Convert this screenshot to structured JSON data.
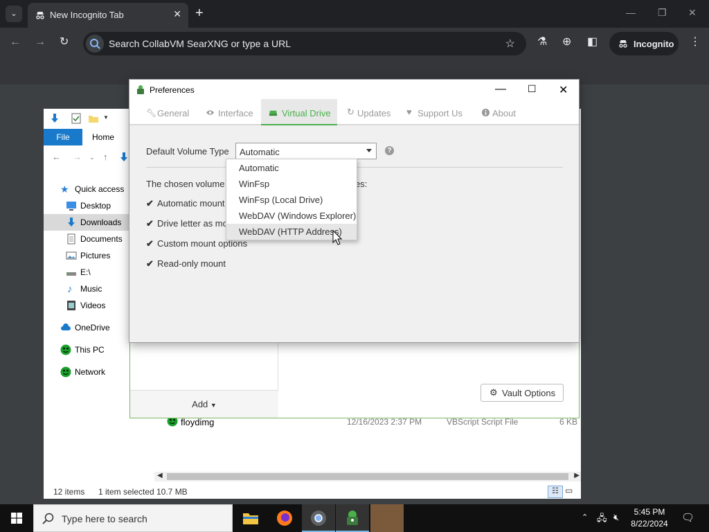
{
  "browser": {
    "tab_title": "New Incognito Tab",
    "omnibox_placeholder": "Search CollabVM SearXNG or type a URL",
    "incognito_label": "Incognito"
  },
  "explorer": {
    "ribbon": {
      "file_tab": "File",
      "home_tab": "Home"
    },
    "sidebar": [
      {
        "label": "Quick access",
        "icon": "star-icon"
      },
      {
        "label": "Desktop",
        "icon": "desktop-icon"
      },
      {
        "label": "Downloads",
        "icon": "download-icon",
        "selected": true
      },
      {
        "label": "Documents",
        "icon": "document-icon"
      },
      {
        "label": "Pictures",
        "icon": "pictures-icon"
      },
      {
        "label": "E:\\",
        "icon": "drive-icon"
      },
      {
        "label": "Music",
        "icon": "music-icon"
      },
      {
        "label": "Videos",
        "icon": "video-icon"
      },
      {
        "label": "OneDrive",
        "icon": "cloud-icon"
      },
      {
        "label": "This PC",
        "icon": "pc-icon"
      },
      {
        "label": "Network",
        "icon": "network-icon"
      }
    ],
    "file_row": {
      "name": "floydimg",
      "date": "12/16/2023 2:37 PM",
      "type": "VBScript Script File",
      "size": "6 KB"
    },
    "status": {
      "items": "12 items",
      "selected": "1 item selected",
      "size": "10.7 MB"
    }
  },
  "cryptomator": {
    "add_label": "Add",
    "vault_options_label": "Vault Options"
  },
  "preferences": {
    "title": "Preferences",
    "tabs": [
      {
        "label": "General",
        "icon": "wrench-icon"
      },
      {
        "label": "Interface",
        "icon": "eye-icon"
      },
      {
        "label": "Virtual Drive",
        "icon": "drive-icon",
        "active": true
      },
      {
        "label": "Updates",
        "icon": "refresh-icon"
      },
      {
        "label": "Support Us",
        "icon": "heart-icon"
      },
      {
        "label": "About",
        "icon": "info-icon"
      }
    ],
    "volume_type_label": "Default Volume Type",
    "volume_type_value": "Automatic",
    "chosen_text": "The chosen volume t",
    "chosen_tail": "es:",
    "features": [
      "Automatic mount",
      "Drive letter as mo",
      "Custom mount options",
      "Read-only mount"
    ],
    "dropdown_options": [
      "Automatic",
      "WinFsp",
      "WinFsp (Local Drive)",
      "WebDAV (Windows Explorer)",
      "WebDAV (HTTP Address)"
    ],
    "hovered_option": "WebDAV (HTTP Address)"
  },
  "taskbar": {
    "search_placeholder": "Type here to search",
    "time": "5:45 PM",
    "date": "8/22/2024"
  },
  "colors": {
    "accent_green": "#49b04a",
    "explorer_blue": "#1979ca",
    "chrome_dark": "#202124"
  }
}
